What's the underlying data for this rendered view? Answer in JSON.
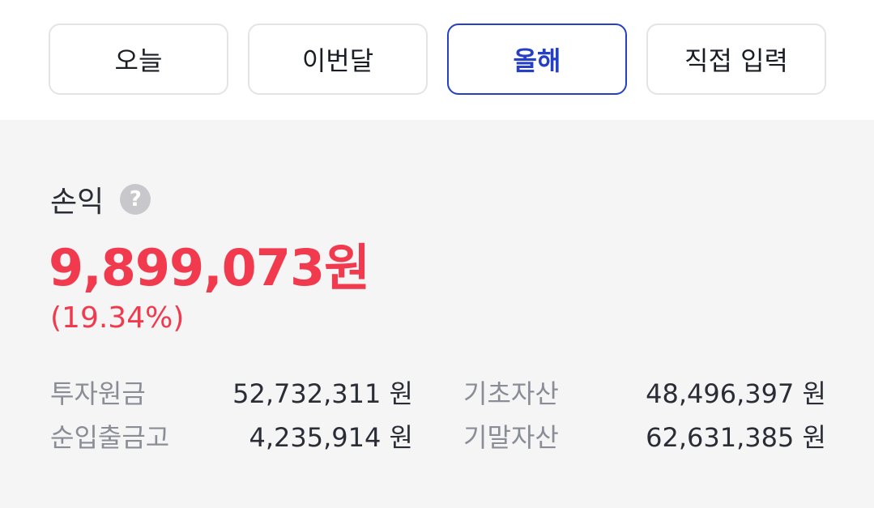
{
  "period_tabs": [
    {
      "label": "오늘"
    },
    {
      "label": "이번달"
    },
    {
      "label": "올해"
    },
    {
      "label": "직접 입력"
    }
  ],
  "selected_period": "올해",
  "summary": {
    "title": "손익",
    "help_icon": "question-circle-icon",
    "profit_amount": "9,899,073원",
    "profit_rate": "(19.34%)",
    "stats": {
      "invested_principal": {
        "label": "투자원금",
        "value": "52,732,311 원"
      },
      "beginning_assets": {
        "label": "기초자산",
        "value": "48,496,397 원"
      },
      "net_deposit_withdrawal": {
        "label": "순입출금고",
        "value": "4,235,914 원"
      },
      "ending_assets": {
        "label": "기말자산",
        "value": "62,631,385 원"
      }
    }
  },
  "colors": {
    "accent": "#2540c4",
    "profit": "#f23a4e",
    "panel_bg": "#f5f5f6",
    "tab_border": "#e4e4e6"
  }
}
